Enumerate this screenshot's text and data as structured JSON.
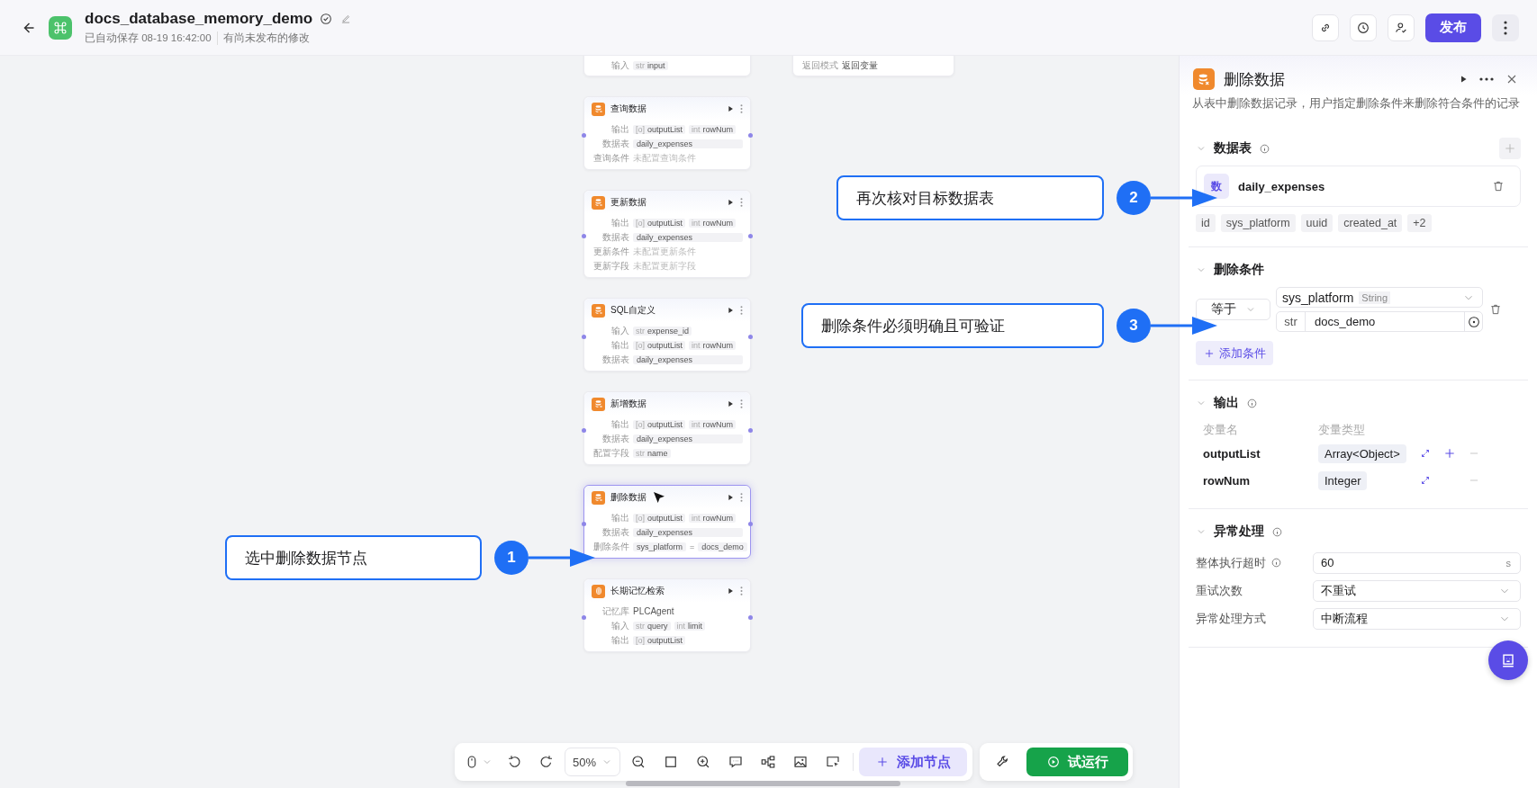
{
  "header": {
    "title": "docs_database_memory_demo",
    "autosave": "已自动保存 08-19 16:42:00",
    "status": "有尚未发布的修改",
    "publish": "发布"
  },
  "canvas": {
    "nodes": [
      {
        "kind": "partial",
        "rows": [
          {
            "kind": "chips",
            "label": "输入",
            "chips": [
              {
                "type": "str",
                "name": "input"
              }
            ]
          }
        ]
      },
      {
        "kind": "database",
        "title": "查询数据",
        "selected": false,
        "rows": [
          {
            "kind": "chips",
            "label": "输出",
            "chips": [
              {
                "type": "[o]",
                "name": "outputList"
              },
              {
                "type": "int",
                "name": "rowNum"
              }
            ]
          },
          {
            "kind": "field",
            "label": "数据表",
            "value": "daily_expenses"
          },
          {
            "kind": "hint",
            "label": "查询条件",
            "value": "未配置查询条件"
          }
        ]
      },
      {
        "kind": "database",
        "title": "更新数据",
        "selected": false,
        "rows": [
          {
            "kind": "chips",
            "label": "输出",
            "chips": [
              {
                "type": "[o]",
                "name": "outputList"
              },
              {
                "type": "int",
                "name": "rowNum"
              }
            ]
          },
          {
            "kind": "field",
            "label": "数据表",
            "value": "daily_expenses"
          },
          {
            "kind": "hint",
            "label": "更新条件",
            "value": "未配置更新条件"
          },
          {
            "kind": "hint",
            "label": "更新字段",
            "value": "未配置更新字段"
          }
        ]
      },
      {
        "kind": "database",
        "title": "SQL自定义",
        "selected": false,
        "rows": [
          {
            "kind": "chips",
            "label": "输入",
            "chips": [
              {
                "type": "str",
                "name": "expense_id"
              }
            ]
          },
          {
            "kind": "chips",
            "label": "输出",
            "chips": [
              {
                "type": "[o]",
                "name": "outputList"
              },
              {
                "type": "int",
                "name": "rowNum"
              }
            ]
          },
          {
            "kind": "field",
            "label": "数据表",
            "value": "daily_expenses"
          }
        ]
      },
      {
        "kind": "database",
        "title": "新增数据",
        "selected": false,
        "rows": [
          {
            "kind": "chips",
            "label": "输出",
            "chips": [
              {
                "type": "[o]",
                "name": "outputList"
              },
              {
                "type": "int",
                "name": "rowNum"
              }
            ]
          },
          {
            "kind": "field",
            "label": "数据表",
            "value": "daily_expenses"
          },
          {
            "kind": "chips",
            "label": "配置字段",
            "chips": [
              {
                "type": "str",
                "name": "name"
              }
            ]
          }
        ]
      },
      {
        "kind": "database",
        "title": "删除数据",
        "selected": true,
        "rows": [
          {
            "kind": "chips",
            "label": "输出",
            "chips": [
              {
                "type": "[o]",
                "name": "outputList"
              },
              {
                "type": "int",
                "name": "rowNum"
              }
            ]
          },
          {
            "kind": "field",
            "label": "数据表",
            "value": "daily_expenses"
          },
          {
            "kind": "condition",
            "label": "删除条件",
            "left": "sys_platform",
            "op": "=",
            "right": "docs_demo"
          }
        ]
      },
      {
        "kind": "memory",
        "title": "长期记忆检索",
        "selected": false,
        "rows": [
          {
            "kind": "text",
            "label": "记忆库",
            "value": "PLCAgent"
          },
          {
            "kind": "chips",
            "label": "输入",
            "chips": [
              {
                "type": "str",
                "name": "query"
              },
              {
                "type": "int",
                "name": "limit"
              }
            ]
          },
          {
            "kind": "chips",
            "label": "输出",
            "chips": [
              {
                "type": "[o]",
                "name": "outputList"
              }
            ]
          }
        ]
      }
    ],
    "stray_node": {
      "rows": [
        {
          "kind": "text",
          "label": "返回模式",
          "value": "返回变量"
        }
      ]
    }
  },
  "callouts": [
    {
      "number": "1",
      "text": "选中删除数据节点"
    },
    {
      "number": "2",
      "text": "再次核对目标数据表"
    },
    {
      "number": "3",
      "text": "删除条件必须明确且可验证"
    }
  ],
  "panel": {
    "title": "删除数据",
    "description": "从表中删除数据记录，用户指定删除条件来删除符合条件的记录",
    "table_section": {
      "title": "数据表",
      "info": true,
      "expanded": true,
      "badge": "数",
      "table_name": "daily_expenses",
      "fields": [
        "id",
        "sys_platform",
        "uuid",
        "created_at",
        "+2"
      ]
    },
    "condition_section": {
      "title": "删除条件",
      "info": false,
      "expanded": true,
      "operator": "等于",
      "field": "sys_platform",
      "field_type": "String",
      "value_type": "str",
      "value": "docs_demo",
      "add_label": "添加条件"
    },
    "output_section": {
      "title": "输出",
      "info": true,
      "expanded": true,
      "col_name": "变量名",
      "col_type": "变量类型",
      "rows": [
        {
          "name": "outputList",
          "type": "Array<Object>",
          "can_add": true
        },
        {
          "name": "rowNum",
          "type": "Integer",
          "can_add": false
        }
      ]
    },
    "error_section": {
      "title": "异常处理",
      "info": true,
      "expanded": true,
      "fields": [
        {
          "kind": "input",
          "label": "整体执行超时",
          "info": true,
          "value": "60",
          "unit": "s"
        },
        {
          "kind": "select",
          "label": "重试次数",
          "info": false,
          "value": "不重试"
        },
        {
          "kind": "select",
          "label": "异常处理方式",
          "info": false,
          "value": "中断流程"
        }
      ]
    }
  },
  "toolbar": {
    "zoom": "50%",
    "add_node": "添加节点",
    "run": "试运行"
  }
}
